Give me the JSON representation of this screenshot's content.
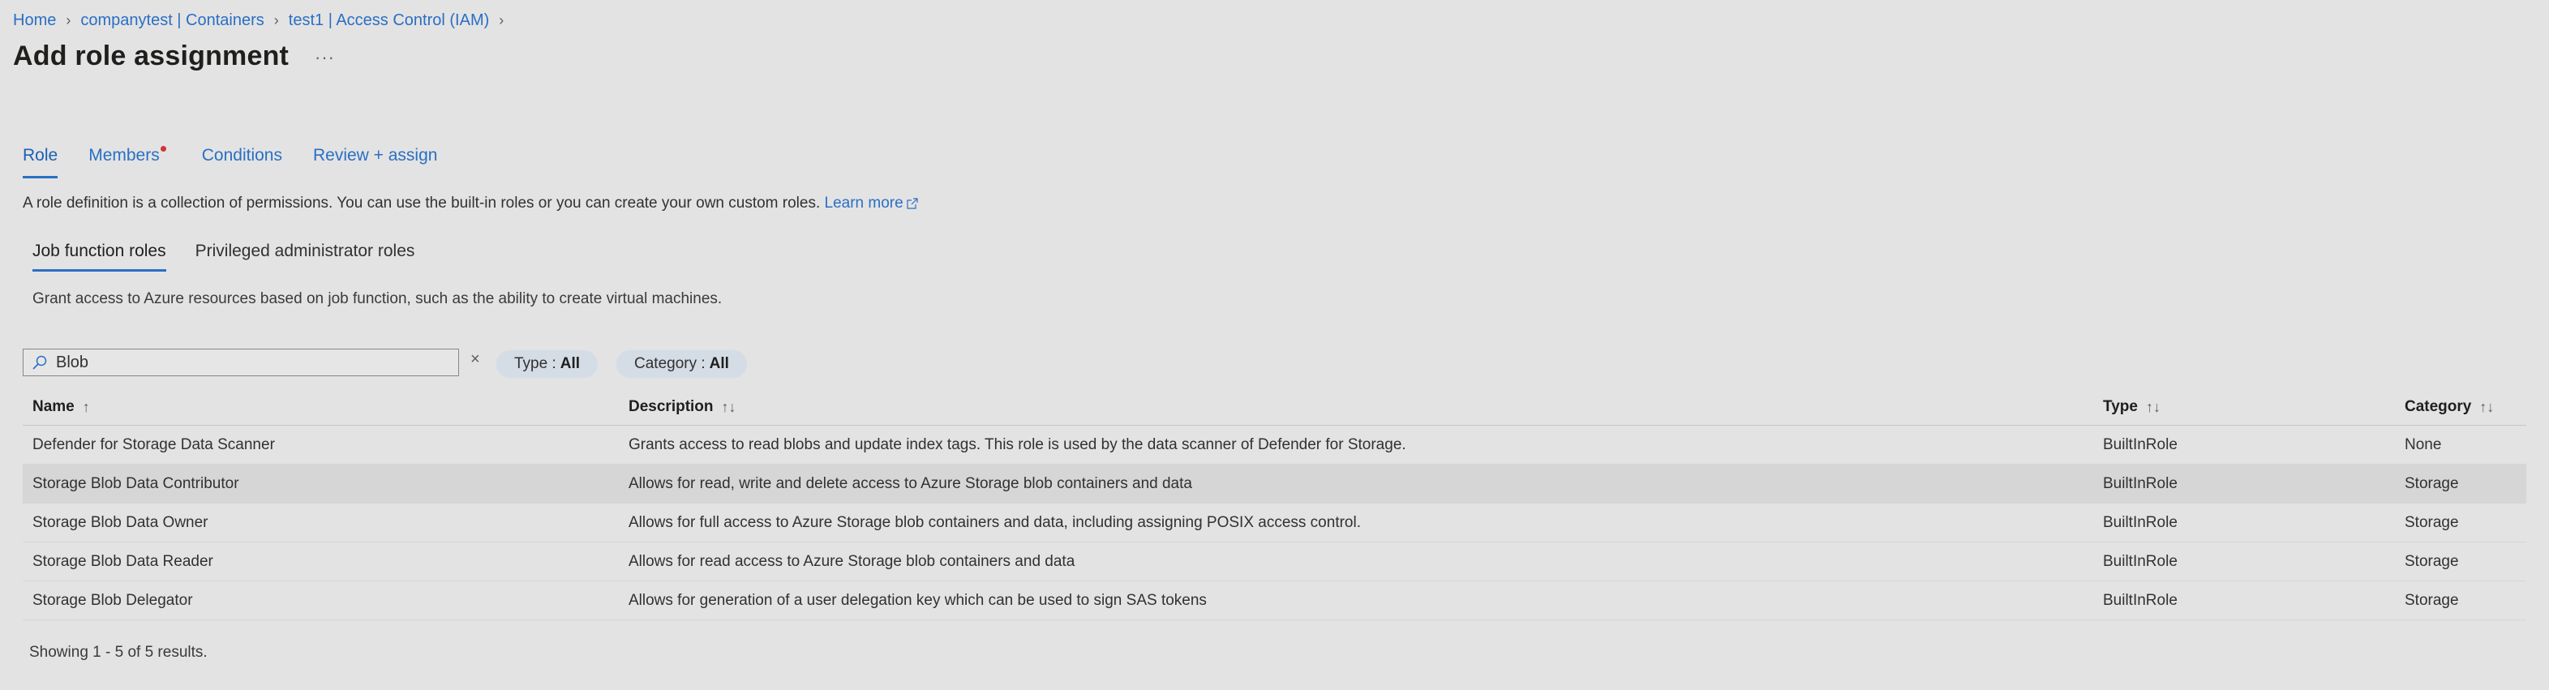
{
  "breadcrumb": [
    {
      "label": "Home"
    },
    {
      "label": "companytest | Containers"
    },
    {
      "label": "test1 | Access Control (IAM)"
    }
  ],
  "page_title": "Add role assignment",
  "more_label": "···",
  "main_tabs": [
    {
      "label": "Role",
      "active": true
    },
    {
      "label": "Members",
      "required": true
    },
    {
      "label": "Conditions"
    },
    {
      "label": "Review + assign"
    }
  ],
  "description": {
    "text": "A role definition is a collection of permissions. You can use the built-in roles or you can create your own custom roles.",
    "link": "Learn more"
  },
  "sub_tabs": [
    {
      "label": "Job function roles",
      "active": true
    },
    {
      "label": "Privileged administrator roles"
    }
  ],
  "sub_description": "Grant access to Azure resources based on job function, such as the ability to create virtual machines.",
  "search": {
    "value": "Blob",
    "clear_label": "×"
  },
  "filters": {
    "type": {
      "label": "Type :",
      "value": "All"
    },
    "category": {
      "label": "Category :",
      "value": "All"
    }
  },
  "table": {
    "columns": {
      "name": "Name",
      "description": "Description",
      "type": "Type",
      "category": "Category"
    },
    "sort_icons": {
      "name": "↑",
      "other": "↑↓"
    },
    "rows": [
      {
        "name": "Defender for Storage Data Scanner",
        "description": "Grants access to read blobs and update index tags. This role is used by the data scanner of Defender for Storage.",
        "type": "BuiltInRole",
        "category": "None"
      },
      {
        "name": "Storage Blob Data Contributor",
        "description": "Allows for read, write and delete access to Azure Storage blob containers and data",
        "type": "BuiltInRole",
        "category": "Storage",
        "highlighted": true
      },
      {
        "name": "Storage Blob Data Owner",
        "description": "Allows for full access to Azure Storage blob containers and data, including assigning POSIX access control.",
        "type": "BuiltInRole",
        "category": "Storage"
      },
      {
        "name": "Storage Blob Data Reader",
        "description": "Allows for read access to Azure Storage blob containers and data",
        "type": "BuiltInRole",
        "category": "Storage"
      },
      {
        "name": "Storage Blob Delegator",
        "description": "Allows for generation of a user delegation key which can be used to sign SAS tokens",
        "type": "BuiltInRole",
        "category": "Storage"
      }
    ]
  },
  "results_text": "Showing 1 - 5 of 5 results.",
  "colors": {
    "accent": "#2a6fc4",
    "required_dot": "#d13438",
    "pill_bg": "#d4dce6",
    "page_bg": "#e3e3e3"
  },
  "icons": {
    "search": "search-icon",
    "external_link": "external-link-icon",
    "chevron": "chevron-right-icon"
  }
}
